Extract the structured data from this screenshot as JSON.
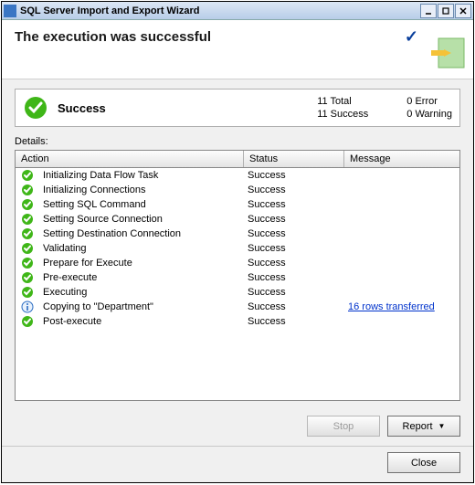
{
  "window": {
    "title": "SQL Server Import and Export Wizard"
  },
  "banner": {
    "title": "The execution was successful"
  },
  "summary": {
    "label": "Success",
    "col1": {
      "line1": "11 Total",
      "line2": "11 Success"
    },
    "col2": {
      "line1": "0  Error",
      "line2": "0  Warning"
    }
  },
  "details_label": "Details:",
  "columns": {
    "action": "Action",
    "status": "Status",
    "message": "Message"
  },
  "rows": [
    {
      "icon": "success",
      "action": "Initializing Data Flow Task",
      "status": "Success",
      "message": ""
    },
    {
      "icon": "success",
      "action": "Initializing Connections",
      "status": "Success",
      "message": ""
    },
    {
      "icon": "success",
      "action": "Setting SQL Command",
      "status": "Success",
      "message": ""
    },
    {
      "icon": "success",
      "action": "Setting Source Connection",
      "status": "Success",
      "message": ""
    },
    {
      "icon": "success",
      "action": "Setting Destination Connection",
      "status": "Success",
      "message": ""
    },
    {
      "icon": "success",
      "action": "Validating",
      "status": "Success",
      "message": ""
    },
    {
      "icon": "success",
      "action": "Prepare for Execute",
      "status": "Success",
      "message": ""
    },
    {
      "icon": "success",
      "action": "Pre-execute",
      "status": "Success",
      "message": ""
    },
    {
      "icon": "success",
      "action": "Executing",
      "status": "Success",
      "message": ""
    },
    {
      "icon": "info",
      "action": "Copying to \"Department\"",
      "status": "Success",
      "message": "16 rows transferred",
      "is_link": true
    },
    {
      "icon": "success",
      "action": "Post-execute",
      "status": "Success",
      "message": ""
    }
  ],
  "buttons": {
    "stop": "Stop",
    "report": "Report",
    "close": "Close"
  }
}
